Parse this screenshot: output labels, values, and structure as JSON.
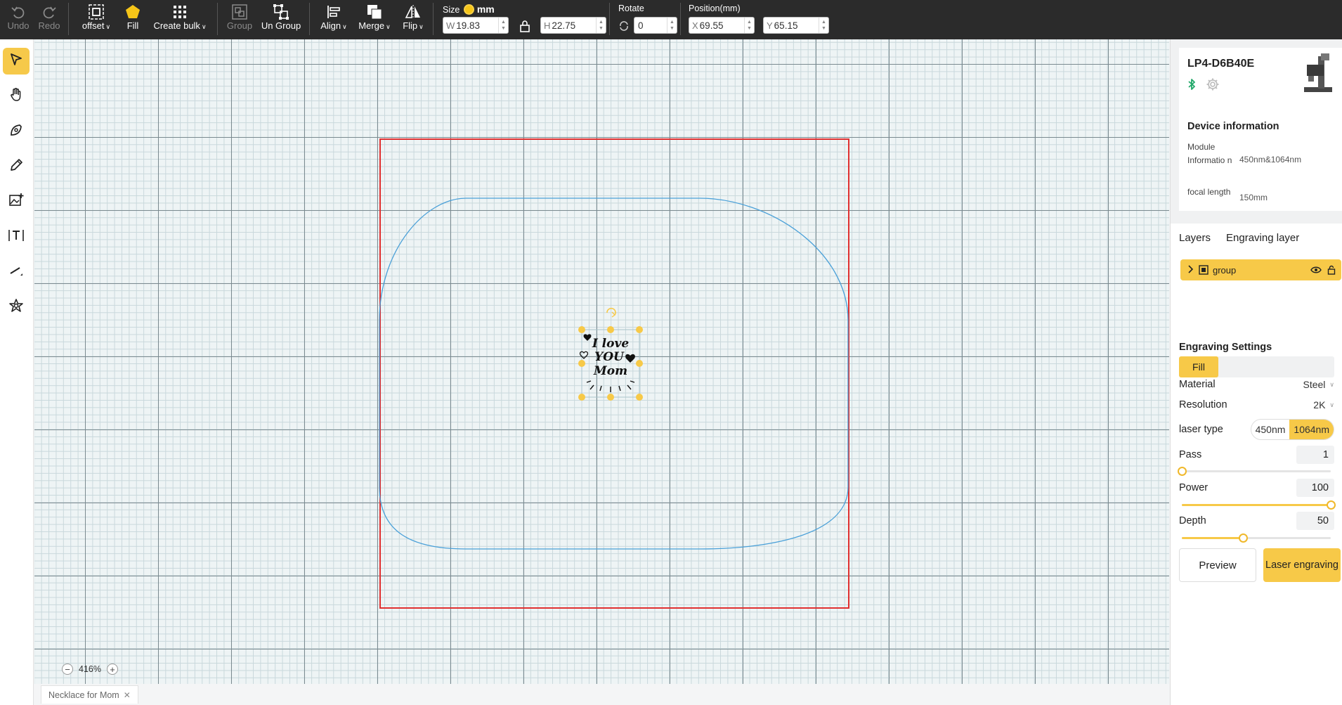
{
  "toolbar": {
    "undo": "Undo",
    "redo": "Redo",
    "offset": "offset",
    "fill": "Fill",
    "create_bulk": "Create bulk",
    "group": "Group",
    "ungroup": "Un Group",
    "align": "Align",
    "merge": "Merge",
    "flip": "Flip",
    "size_label": "Size",
    "unit": "mm",
    "width_prefix": "W",
    "width": "19.83",
    "height_prefix": "H",
    "height": "22.75",
    "rotate_label": "Rotate",
    "rotate": "0",
    "position_label": "Position(mm)",
    "x_prefix": "X",
    "x": "69.55",
    "y_prefix": "Y",
    "y": "65.15"
  },
  "left_tools": [
    "select-tool",
    "pan-tool",
    "pen-tool",
    "pencil-tool",
    "image-tool",
    "text-tool",
    "line-tool",
    "shape-tool"
  ],
  "canvas": {
    "zoom": "416%",
    "artwork_text": [
      "I love",
      "YOU",
      "Mom"
    ],
    "colors": {
      "workarea_border": "#e03030",
      "shape_stroke": "#4aa0d8",
      "handle": "#f7c948"
    }
  },
  "file_tab": {
    "name": "Necklace for Mom"
  },
  "device": {
    "name": "LP4-D6B40E",
    "info_title": "Device information",
    "module_label": "Module Informatio n",
    "module_value": "450nm&1064nm",
    "focal_label": "focal length",
    "focal_value": "150mm"
  },
  "layers": {
    "tabs": [
      "Layers",
      "Engraving layer"
    ],
    "items": [
      {
        "name": "group"
      }
    ]
  },
  "engraving": {
    "title": "Engraving Settings",
    "mode": "Fill",
    "material_label": "Material",
    "material": "Steel",
    "resolution_label": "Resolution",
    "resolution": "2K",
    "laser_label": "laser type",
    "laser_options": [
      "450nm",
      "1064nm"
    ],
    "laser_selected": "1064nm",
    "pass_label": "Pass",
    "pass": "1",
    "pass_level": 0.0,
    "power_label": "Power",
    "power": "100",
    "power_level": 1.0,
    "depth_label": "Depth",
    "depth": "50",
    "depth_level": 0.41,
    "preview": "Preview",
    "laser_engraving": "Laser engraving"
  },
  "accent_color": "#f7c948"
}
